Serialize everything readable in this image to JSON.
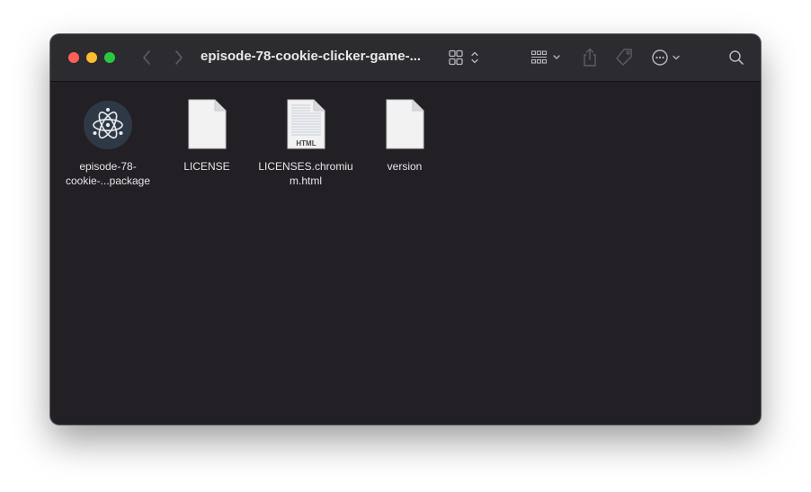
{
  "window": {
    "title": "episode-78-cookie-clicker-game-..."
  },
  "toolbar": {
    "back_icon": "chevron-left-icon",
    "forward_icon": "chevron-right-icon",
    "view_icon": "grid-view-icon",
    "group_icon": "group-by-icon",
    "share_icon": "share-icon",
    "tag_icon": "tag-icon",
    "more_icon": "ellipsis-circle-icon",
    "search_icon": "search-icon"
  },
  "files": [
    {
      "name": "episode-78-\ncookie-...package",
      "icon": "electron-app-icon"
    },
    {
      "name": "LICENSE",
      "icon": "document-icon"
    },
    {
      "name": "LICENSES.chromium.html",
      "icon": "html-document-icon",
      "badge": "HTML"
    },
    {
      "name": "version",
      "icon": "document-icon"
    }
  ],
  "colors": {
    "close": "#fe5f57",
    "minimize": "#febc2e",
    "maximize": "#28c840",
    "window_bg": "#222025",
    "titlebar_bg": "#2c2b30"
  }
}
